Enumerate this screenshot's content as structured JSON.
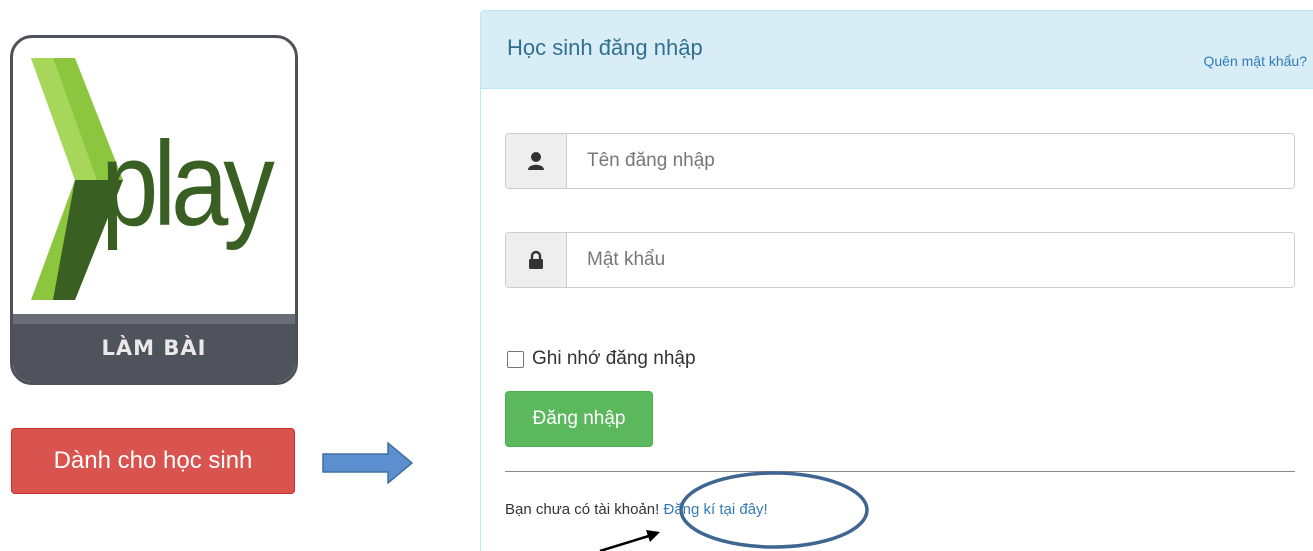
{
  "logo": {
    "word": "play",
    "band_label": "LÀM BÀI",
    "colors": {
      "chevron_light": "#8cc63f",
      "chevron_dark": "#3a5f22",
      "band": "#50535b"
    }
  },
  "student_button": {
    "label": "Dành cho học sinh",
    "color": "#d9534f"
  },
  "login_panel": {
    "title": "Học sinh đăng nhập",
    "forgot_link": "Quên mật khẩu?",
    "username": {
      "placeholder": "Tên đăng nhập",
      "icon": "user-icon"
    },
    "password": {
      "placeholder": "Mật khẩu",
      "icon": "lock-icon"
    },
    "remember_label": "Ghi nhớ đăng nhập",
    "remember_checked": false,
    "submit_label": "Đăng nhập",
    "signup_prefix": "Bạn chưa có tài khoản! ",
    "signup_link": "Đăng kí tại đây!",
    "colors": {
      "heading_bg": "#d9edf7",
      "heading_text": "#31708f",
      "link": "#337ab7",
      "submit": "#5cb85c"
    }
  },
  "annotations": {
    "arrow_color": "#5b8fd0",
    "ellipse_color": "#3e6690"
  }
}
